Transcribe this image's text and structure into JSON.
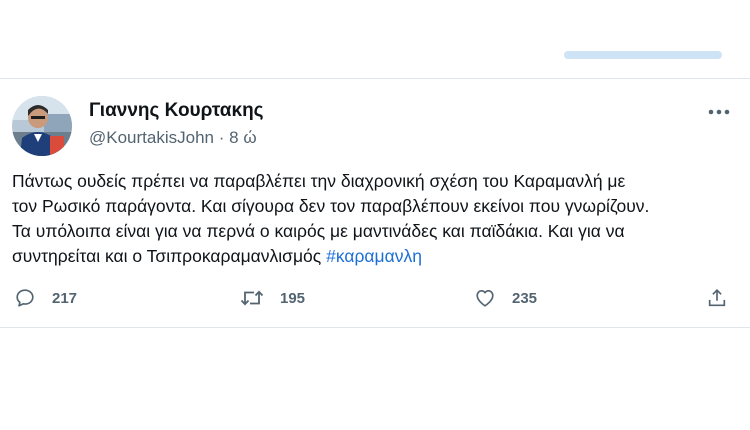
{
  "header": {
    "display_name": "Γιαννης Κουρτακης",
    "handle": "@KourtakisJohn",
    "separator": "·",
    "time": "8 ώ",
    "more_icon": "more-horizontal-icon"
  },
  "tweet": {
    "lines": [
      "Πάντως ουδείς πρέπει να παραβλέπει την διαχρονική σχέση του Καραμανλή με",
      "τον Ρωσικό παράγοντα. Και σίγουρα δεν τον παραβλέπουν εκείνοι που γνωρίζουν.",
      "Τα υπόλοιπα είναι για να περνά ο καιρός με μαντινάδες και παϊδάκια. Και για να",
      "συντηρείται και ο Τσιπροκαραμανλισμός"
    ],
    "hashtag": "#καραμανλη",
    "hashtag_color": "#1d6fd8"
  },
  "actions": {
    "reply": {
      "icon": "reply-icon",
      "count": "217"
    },
    "retweet": {
      "icon": "retweet-icon",
      "count": "195"
    },
    "like": {
      "icon": "heart-icon",
      "count": "235"
    },
    "share": {
      "icon": "share-icon"
    }
  },
  "colors": {
    "text": "#0f1419",
    "muted": "#536471",
    "divider": "#e1e6ea",
    "accent_pill": "#cfe3f7"
  }
}
